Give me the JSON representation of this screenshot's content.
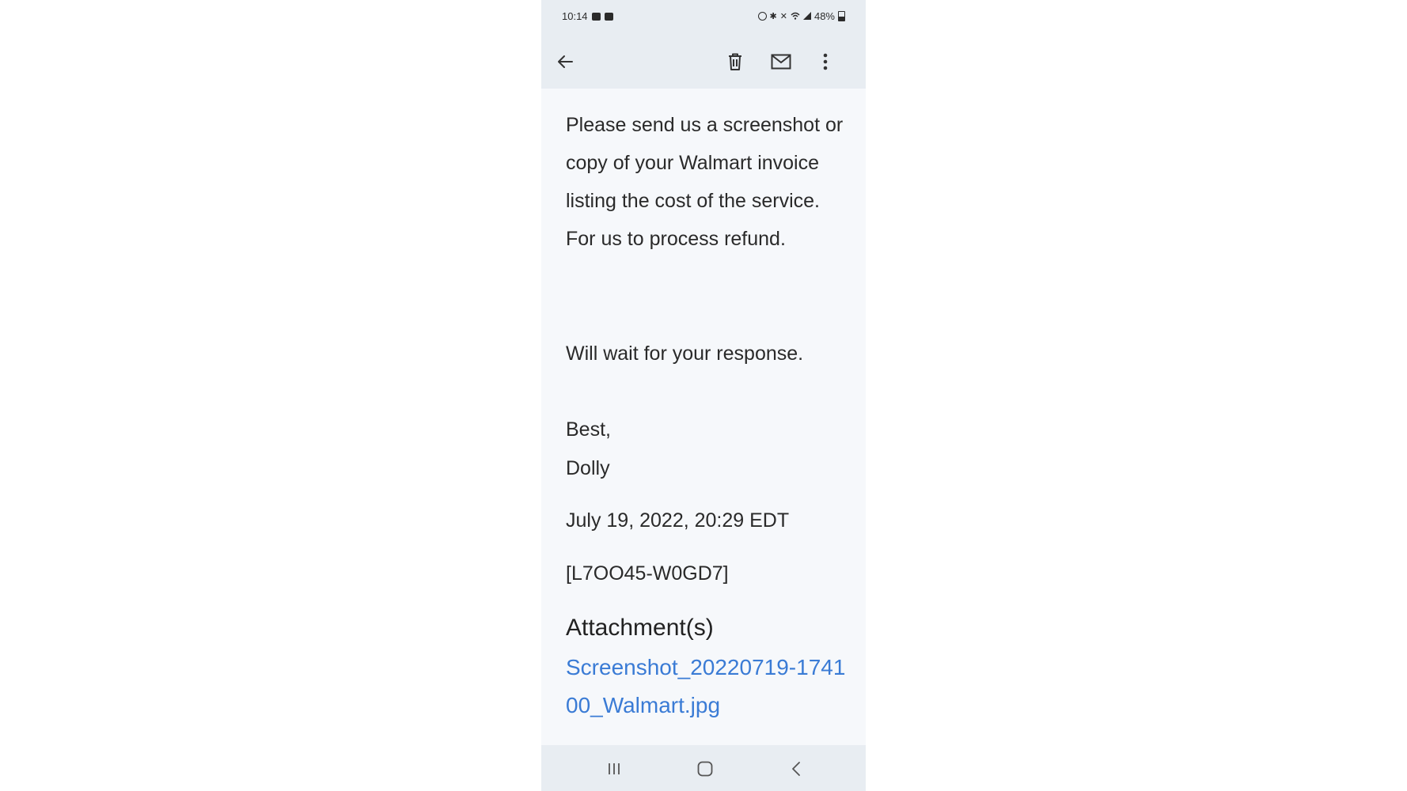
{
  "status_bar": {
    "time": "10:14",
    "battery": "48%",
    "left_icons": [
      "gallery-icon",
      "youtube-icon"
    ],
    "right_icons": [
      "alarm-icon",
      "bluetooth-icon",
      "mute-icon",
      "wifi-icon",
      "signal-icon",
      "battery-icon"
    ]
  },
  "toolbar": {
    "icons": [
      "back-arrow-icon",
      "trash-icon",
      "mail-icon",
      "more-vert-icon"
    ]
  },
  "email": {
    "paragraph1": "Please send us a screenshot or copy of your Walmart invoice listing the cost of the service. For us to process refund.",
    "paragraph2": "Will wait for your response.",
    "signoff": "Best,",
    "signature": "Dolly",
    "date": "July 19, 2022, 20:29 EDT",
    "reference": "[L7OO45-W0GD7]",
    "attachments_heading": "Attachment(s)",
    "attachment_name": "Screenshot_20220719-174100_Walmart.jpg"
  },
  "nav_bar": {
    "icons": [
      "recents-icon",
      "home-icon",
      "back-icon"
    ]
  },
  "colors": {
    "bar_bg": "#e8edf2",
    "content_bg": "#f6f8fb",
    "link": "#3a7bd5"
  }
}
